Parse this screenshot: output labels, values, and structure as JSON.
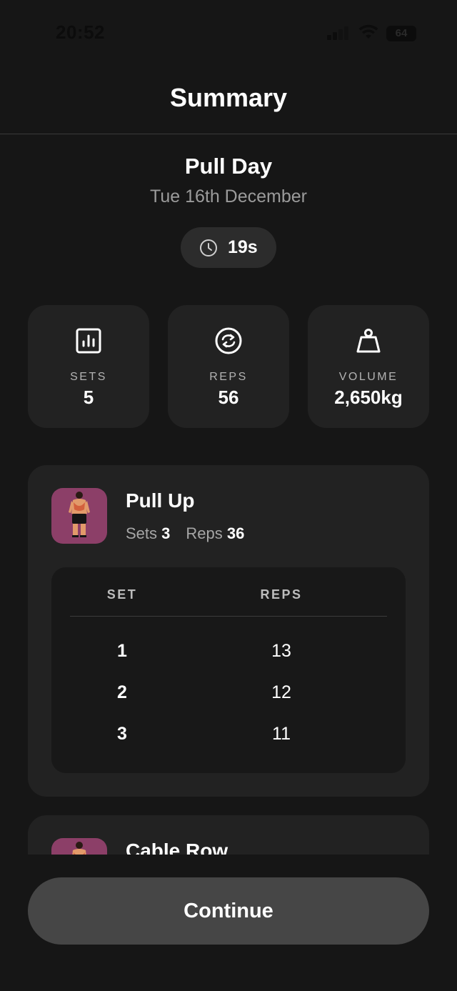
{
  "status_bar": {
    "time": "20:52",
    "battery": "64"
  },
  "header": {
    "title": "Summary"
  },
  "workout": {
    "name": "Pull Day",
    "date": "Tue 16th December",
    "duration": "19s"
  },
  "stats": [
    {
      "label": "SETS",
      "value": "5",
      "icon": "bar-chart-icon"
    },
    {
      "label": "REPS",
      "value": "56",
      "icon": "repeat-icon"
    },
    {
      "label": "VOLUME",
      "value": "2,650kg",
      "icon": "weight-icon"
    }
  ],
  "exercises": [
    {
      "name": "Pull Up",
      "sets_label": "Sets",
      "sets": "3",
      "reps_label": "Reps",
      "reps": "36",
      "table_headers": {
        "set": "SET",
        "reps": "REPS"
      },
      "rows": [
        {
          "set": "1",
          "reps": "13"
        },
        {
          "set": "2",
          "reps": "12"
        },
        {
          "set": "3",
          "reps": "11"
        }
      ]
    },
    {
      "name": "Cable Row"
    }
  ],
  "continue_label": "Continue",
  "colors": {
    "background": "#161616",
    "card": "#222222",
    "thumb": "#8c3f68",
    "button": "#464646"
  }
}
